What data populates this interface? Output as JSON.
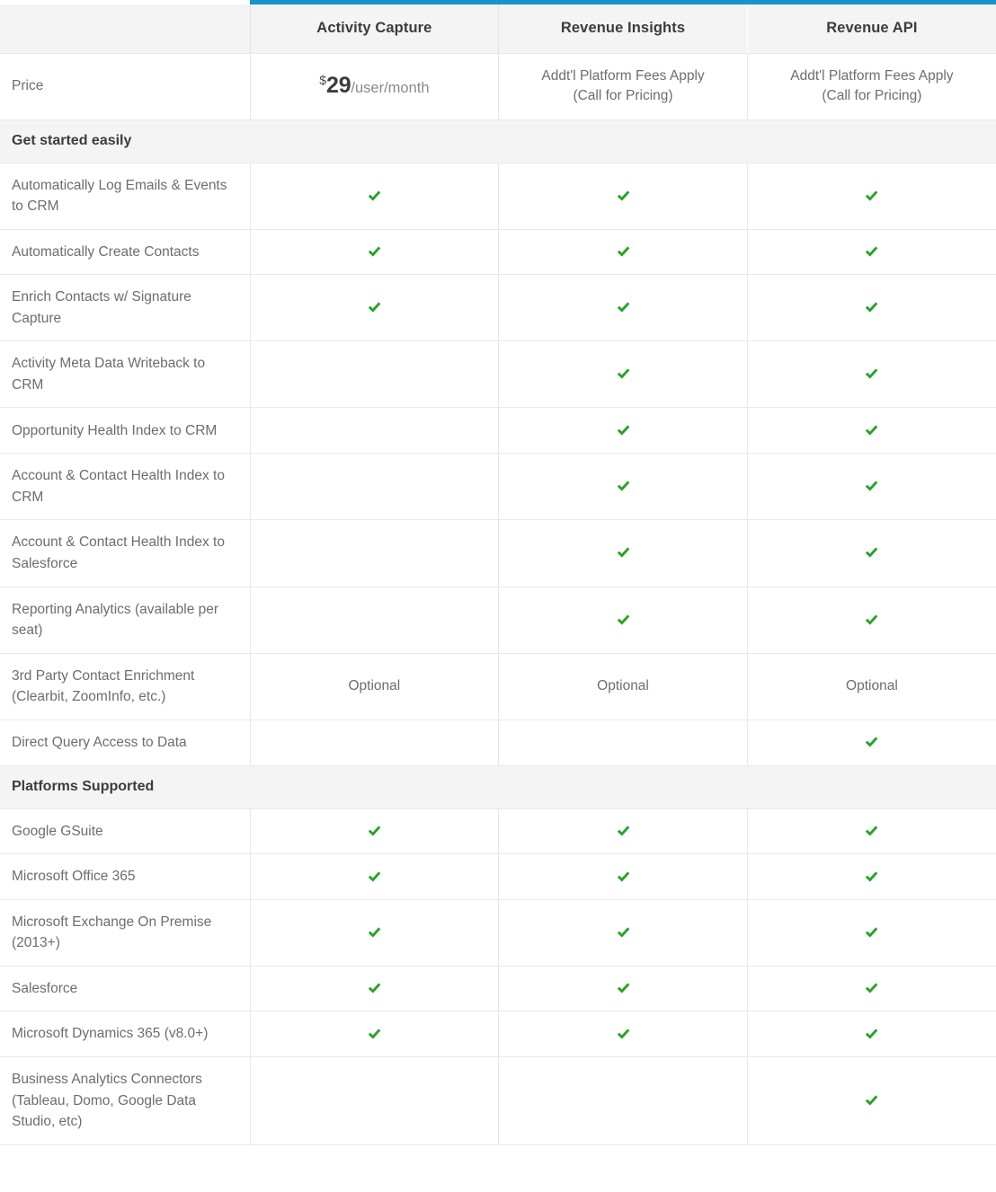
{
  "accent_color": "#1595c9",
  "check_color": "#27a327",
  "table": {
    "feature_column_header": "",
    "plans": [
      {
        "name": "Activity Capture",
        "featured": true
      },
      {
        "name": "Revenue Insights",
        "featured": false
      },
      {
        "name": "Revenue API",
        "featured": false
      }
    ],
    "price_row": {
      "label": "Price",
      "cells": [
        {
          "type": "price",
          "currency": "$",
          "amount": "29",
          "period": "/user/month"
        },
        {
          "type": "note",
          "line1": "Addt'l Platform Fees Apply",
          "line2": "(Call for Pricing)"
        },
        {
          "type": "note",
          "line1": "Addt'l Platform Fees Apply",
          "line2": "(Call for Pricing)"
        }
      ]
    },
    "sections": [
      {
        "title": "Get started easily",
        "rows": [
          {
            "label": "Automatically Log Emails & Events to CRM",
            "values": [
              "check",
              "check",
              "check"
            ]
          },
          {
            "label": "Automatically Create Contacts",
            "values": [
              "check",
              "check",
              "check"
            ]
          },
          {
            "label": "Enrich Contacts w/ Signature Capture",
            "values": [
              "check",
              "check",
              "check"
            ]
          },
          {
            "label": "Activity Meta Data Writeback to CRM",
            "values": [
              "",
              "check",
              "check"
            ]
          },
          {
            "label": "Opportunity Health Index to CRM",
            "values": [
              "",
              "check",
              "check"
            ]
          },
          {
            "label": "Account & Contact Health Index to CRM",
            "values": [
              "",
              "check",
              "check"
            ]
          },
          {
            "label": "Account & Contact Health Index to Salesforce",
            "values": [
              "",
              "check",
              "check"
            ]
          },
          {
            "label": "Reporting Analytics (available per seat)",
            "values": [
              "",
              "check",
              "check"
            ]
          },
          {
            "label": "3rd Party Contact Enrichment (Clearbit, ZoomInfo, etc.)",
            "values": [
              "Optional",
              "Optional",
              "Optional"
            ]
          },
          {
            "label": "Direct Query Access to Data",
            "values": [
              "",
              "",
              "check"
            ]
          }
        ]
      },
      {
        "title": "Platforms Supported",
        "rows": [
          {
            "label": "Google GSuite",
            "values": [
              "check",
              "check",
              "check"
            ]
          },
          {
            "label": "Microsoft Office 365",
            "values": [
              "check",
              "check",
              "check"
            ]
          },
          {
            "label": "Microsoft Exchange On Premise (2013+)",
            "values": [
              "check",
              "check",
              "check"
            ]
          },
          {
            "label": "Salesforce",
            "values": [
              "check",
              "check",
              "check"
            ]
          },
          {
            "label": "Microsoft Dynamics 365 (v8.0+)",
            "values": [
              "check",
              "check",
              "check"
            ]
          },
          {
            "label": "Business Analytics Connectors (Tableau, Domo, Google Data Studio, etc)",
            "values": [
              "",
              "",
              "check"
            ]
          }
        ]
      }
    ]
  }
}
